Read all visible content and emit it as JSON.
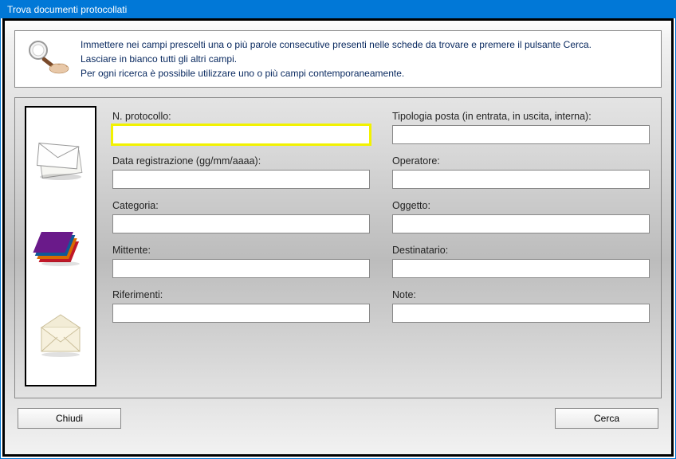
{
  "window": {
    "title": "Trova documenti protocollati"
  },
  "help": {
    "line1": "Immettere nei campi prescelti una o più parole consecutive presenti nelle schede da trovare e premere il pulsante Cerca.",
    "line2": "Lasciare in bianco tutti gli altri campi.",
    "line3": "Per ogni ricerca è possibile utilizzare uno o più campi contemporaneamente."
  },
  "fields": {
    "n_protocollo": {
      "label": "N. protocollo:",
      "value": ""
    },
    "tipologia_posta": {
      "label": "Tipologia posta (in entrata, in uscita, interna):",
      "value": ""
    },
    "data_registrazione": {
      "label": "Data registrazione (gg/mm/aaaa):",
      "value": ""
    },
    "operatore": {
      "label": "Operatore:",
      "value": ""
    },
    "categoria": {
      "label": "Categoria:",
      "value": ""
    },
    "oggetto": {
      "label": "Oggetto:",
      "value": ""
    },
    "mittente": {
      "label": "Mittente:",
      "value": ""
    },
    "destinatario": {
      "label": "Destinatario:",
      "value": ""
    },
    "riferimenti": {
      "label": "Riferimenti:",
      "value": ""
    },
    "note": {
      "label": "Note:",
      "value": ""
    }
  },
  "buttons": {
    "close": "Chiudi",
    "search": "Cerca"
  },
  "icons": {
    "help": "magnifier-icon",
    "col1": "envelopes-stack-icon",
    "col2": "folders-icon",
    "col3": "open-envelope-icon"
  }
}
